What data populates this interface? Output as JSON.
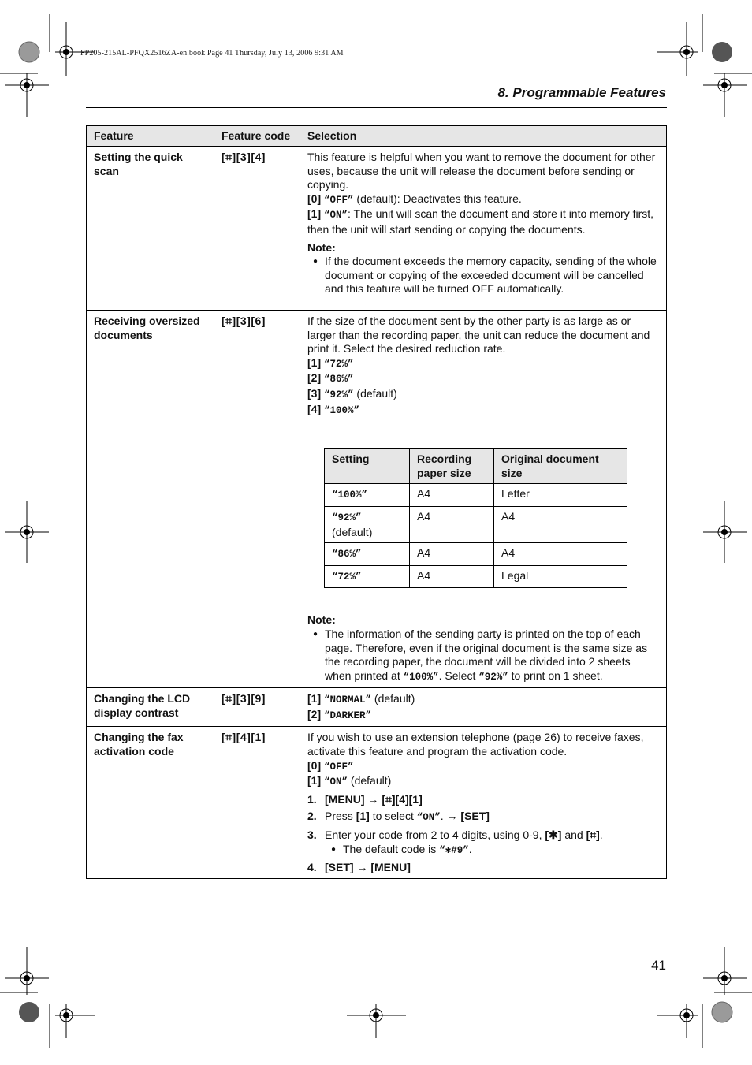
{
  "header": {
    "book_info": "FP205-215AL-PFQX2516ZA-en.book  Page 41  Thursday, July 13, 2006  9:31 AM",
    "section_title": "8. Programmable Features"
  },
  "table": {
    "headers": [
      "Feature",
      "Feature code",
      "Selection"
    ],
    "rows": [
      {
        "feature": "Setting the quick scan",
        "code": "[⌗][3][4]",
        "intro": "This feature is helpful when you want to remove the document for other uses, because the unit will release the document before sending or copying.",
        "options": [
          {
            "key": "[0]",
            "value": "“OFF”",
            "desc": " (default): Deactivates this feature."
          },
          {
            "key": "[1]",
            "value": "“ON”",
            "desc": ": The unit will scan the document and store it into memory first, then the unit will start sending or copying the documents."
          }
        ],
        "note_title": "Note:",
        "note": "If the document exceeds the memory capacity, sending of the whole document or copying of the exceeded document will be cancelled and this feature will be turned OFF automatically."
      },
      {
        "feature": "Receiving oversized documents",
        "code": "[⌗][3][6]",
        "intro": "If the size of the document sent by the other party is as large as or larger than the recording paper, the unit can reduce the document and print it. Select the desired reduction rate.",
        "options": [
          {
            "key": "[1]",
            "value": "“72%”",
            "desc": ""
          },
          {
            "key": "[2]",
            "value": "“86%”",
            "desc": ""
          },
          {
            "key": "[3]",
            "value": "“92%”",
            "desc": " (default)"
          },
          {
            "key": "[4]",
            "value": "“100%”",
            "desc": ""
          }
        ],
        "subtable": {
          "headers": [
            "Setting",
            "Recording paper size",
            "Original document size"
          ],
          "rows": [
            {
              "setting": "“100%”",
              "setting_suffix": "",
              "paper": "A4",
              "original": "Letter"
            },
            {
              "setting": "“92%”",
              "setting_suffix": " (default)",
              "paper": "A4",
              "original": "A4"
            },
            {
              "setting": "“86%”",
              "setting_suffix": "",
              "paper": "A4",
              "original": "A4"
            },
            {
              "setting": "“72%”",
              "setting_suffix": "",
              "paper": "A4",
              "original": "Legal"
            }
          ]
        },
        "note_title": "Note:",
        "note_parts": {
          "a": "The information of the sending party is printed on the top of each page. Therefore, even if the original document is the same size as the recording paper, the document will be divided into 2 sheets when printed at ",
          "b": "“100%”",
          "c": ". Select ",
          "d": "“92%”",
          "e": " to print on 1 sheet."
        }
      },
      {
        "feature": "Changing the LCD display contrast",
        "code": "[⌗][3][9]",
        "options": [
          {
            "key": "[1]",
            "value": "“NORMAL”",
            "desc": " (default)"
          },
          {
            "key": "[2]",
            "value": "“DARKER”",
            "desc": ""
          }
        ]
      },
      {
        "feature": "Changing the fax activation code",
        "code": "[⌗][4][1]",
        "intro": "If you wish to use an extension telephone (page 26) to receive faxes, activate this feature and program the activation code.",
        "options": [
          {
            "key": "[0]",
            "value": "“OFF”",
            "desc": ""
          },
          {
            "key": "[1]",
            "value": "“ON”",
            "desc": " (default)"
          }
        ],
        "steps": [
          {
            "num": "1.",
            "a": "[MENU] → [⌗][4][1]"
          },
          {
            "num": "2.",
            "a": "Press ",
            "b": "[1]",
            "c": " to select ",
            "d": "“ON”",
            "e": ". → ",
            "f": "[SET]"
          },
          {
            "num": "3.",
            "a": "Enter your code from 2 to 4 digits, using 0-9, ",
            "b": "[✱]",
            "c": " and ",
            "d": "[⌗]",
            "e": ".",
            "sub": "The default code is ",
            "sub_code": "“✱#9”",
            "sub_end": "."
          },
          {
            "num": "4.",
            "a": "[SET] → [MENU]"
          }
        ]
      }
    ]
  },
  "footer": {
    "page_number": "41"
  }
}
